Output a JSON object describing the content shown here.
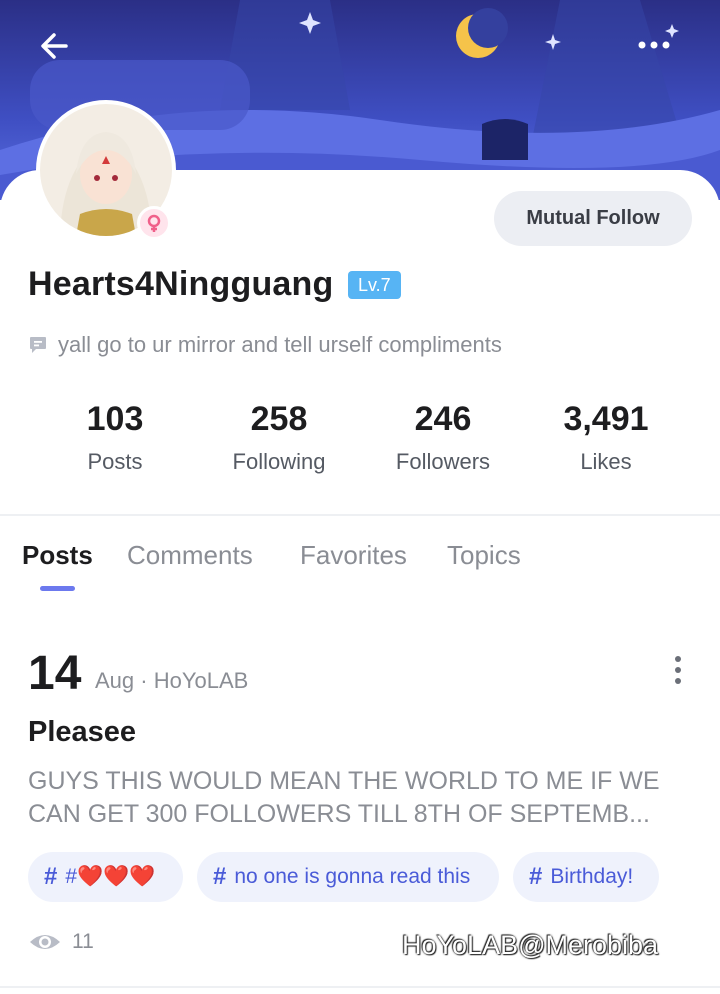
{
  "profile": {
    "username": "Hearts4Ningguang",
    "level": "Lv.7",
    "bio": "yall go to ur mirror and tell urself compliments",
    "mutual_follow_label": "Mutual Follow"
  },
  "stats": [
    {
      "value": "103",
      "label": "Posts"
    },
    {
      "value": "258",
      "label": "Following"
    },
    {
      "value": "246",
      "label": "Followers"
    },
    {
      "value": "3,491",
      "label": "Likes"
    }
  ],
  "tabs": [
    "Posts",
    "Comments",
    "Favorites",
    "Topics"
  ],
  "active_tab": "Posts",
  "post": {
    "day": "14",
    "meta": "Aug · HoYoLAB",
    "title": "Pleasee",
    "body": "GUYS THIS WOULD MEAN THE WORLD TO ME IF WE CAN GET 300 FOLLOWERS TILL 8TH OF SEPTEMB...",
    "tags": [
      "#❤️❤️❤️",
      "no one is gonna read this",
      "Birthday!"
    ],
    "views": "11"
  },
  "watermark": "HoYoLAB@Merobiba",
  "colors": {
    "accent": "#6c79ee",
    "level_badge": "#57b4f4",
    "tag_text": "#4a5bd8",
    "banner": "#3f4fc3"
  },
  "icons": {
    "back": "arrow-left-icon",
    "more": "more-dots-icon",
    "bio": "comment-bubble-icon",
    "views": "eye-icon",
    "post_menu": "vertical-dots-icon"
  }
}
